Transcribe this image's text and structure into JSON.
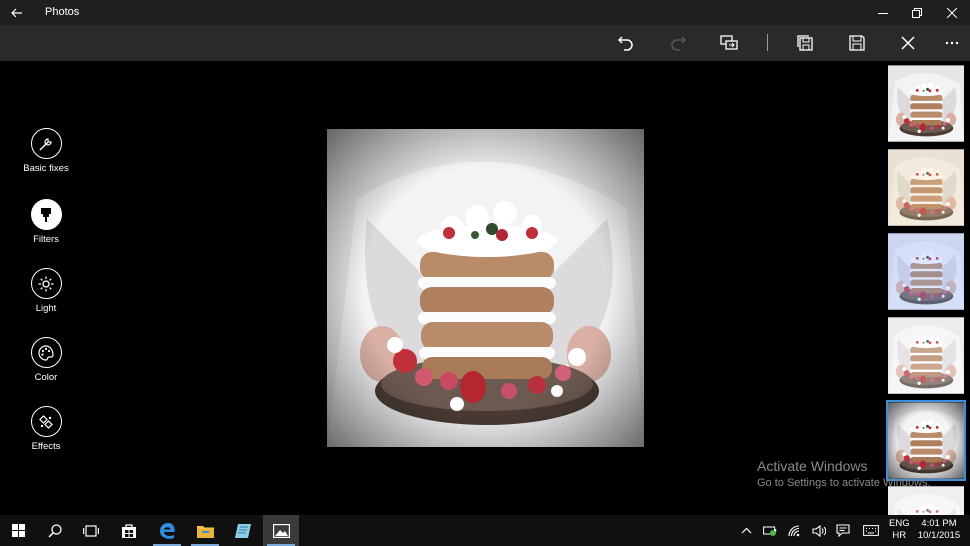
{
  "window": {
    "app_title": "Photos",
    "controls": [
      "minimize-icon",
      "restore-icon",
      "close-icon"
    ]
  },
  "toolbar": {
    "buttons": [
      "undo-icon",
      "redo-icon",
      "compare-icon",
      "save-copy-icon",
      "save-icon",
      "cancel-icon",
      "more-icon"
    ]
  },
  "edit_panel": {
    "tools": [
      {
        "label": "Basic fixes",
        "icon": "wand-icon",
        "active": false
      },
      {
        "label": "Filters",
        "icon": "filter-icon",
        "active": true
      },
      {
        "label": "Light",
        "icon": "sun-icon",
        "active": false
      },
      {
        "label": "Color",
        "icon": "palette-icon",
        "active": false
      },
      {
        "label": "Effects",
        "icon": "effects-icon",
        "active": false
      }
    ]
  },
  "filters": {
    "selected_index": 4,
    "count_visible": 6
  },
  "watermark": {
    "title": "Activate Windows",
    "subtitle": "Go to Settings to activate Windows."
  },
  "taskbar": {
    "apps": [
      "start-icon",
      "search-icon",
      "task-view-icon",
      "store-icon",
      "edge-icon",
      "file-explorer-icon",
      "app-icon",
      "photos-icon"
    ],
    "language_top": "ENG",
    "language_bottom": "HR",
    "time": "4:01 PM",
    "date": "10/1/2015"
  },
  "colors": {
    "titlebar": "#1f1f1f",
    "toolbar": "#2a2a2a",
    "background": "#000000",
    "selection": "#3c8fdc",
    "taskbar": "#101010"
  }
}
